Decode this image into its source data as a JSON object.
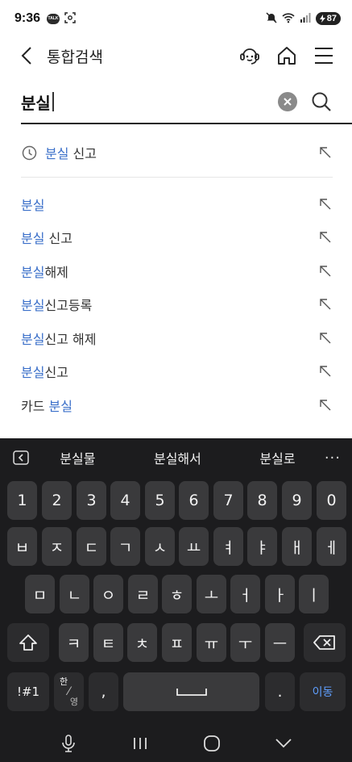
{
  "status": {
    "time": "9:36",
    "talk_badge": "TALK",
    "battery": "87"
  },
  "header": {
    "title": "통합검색"
  },
  "search": {
    "value": "분실"
  },
  "recent": {
    "highlight": "분실",
    "rest": " 신고"
  },
  "suggestions": [
    {
      "pre": "",
      "hl": "분실",
      "post": ""
    },
    {
      "pre": "",
      "hl": "분실",
      "post": " 신고"
    },
    {
      "pre": "",
      "hl": "분실",
      "post": "해제"
    },
    {
      "pre": "",
      "hl": "분실",
      "post": "신고등록"
    },
    {
      "pre": "",
      "hl": "분실",
      "post": "신고 해제"
    },
    {
      "pre": "",
      "hl": "분실",
      "post": "신고"
    },
    {
      "pre": "카드 ",
      "hl": "분실",
      "post": ""
    }
  ],
  "keyboard": {
    "predictions": [
      "분실물",
      "분실해서",
      "분실로"
    ],
    "more": "···",
    "row_numbers": [
      "1",
      "2",
      "3",
      "4",
      "5",
      "6",
      "7",
      "8",
      "9",
      "0"
    ],
    "row1": [
      "ㅂ",
      "ㅈ",
      "ㄷ",
      "ㄱ",
      "ㅅ",
      "ㅛ",
      "ㅕ",
      "ㅑ",
      "ㅐ",
      "ㅔ"
    ],
    "row2": [
      "ㅁ",
      "ㄴ",
      "ㅇ",
      "ㄹ",
      "ㅎ",
      "ㅗ",
      "ㅓ",
      "ㅏ",
      "ㅣ"
    ],
    "row3": [
      "ㅋ",
      "ㅌ",
      "ㅊ",
      "ㅍ",
      "ㅠ",
      "ㅜ",
      "ㅡ"
    ],
    "symbols": "!#1",
    "lang_top": "한",
    "lang_bottom": "영",
    "comma": ",",
    "period": ".",
    "enter": "이동"
  }
}
